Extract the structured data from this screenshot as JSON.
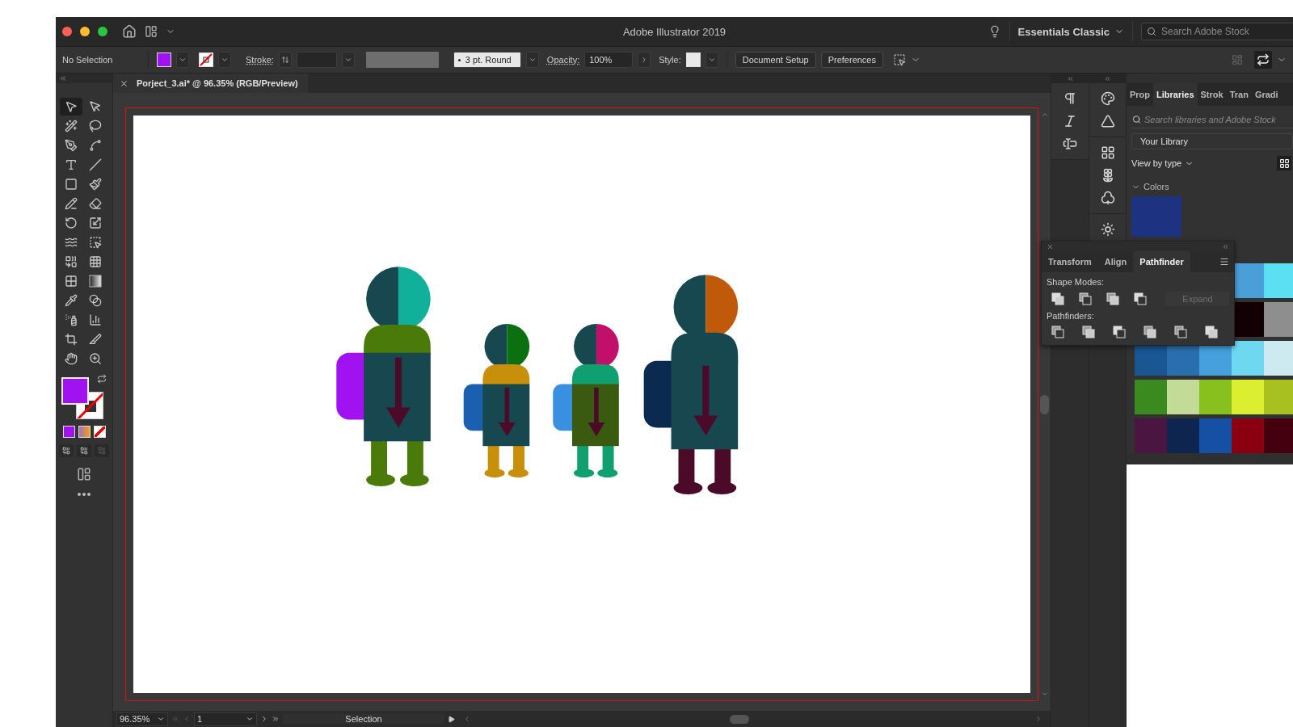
{
  "window": {
    "title": "Adobe Illustrator 2019"
  },
  "workspace": {
    "label": "Essentials Classic"
  },
  "stock_search": {
    "placeholder": "Search Adobe Stock"
  },
  "control_bar": {
    "selection": "No Selection",
    "stroke_label": "Stroke:",
    "brush": "3 pt. Round",
    "opacity_label": "Opacity:",
    "opacity": "100%",
    "style_label": "Style:",
    "buttons": [
      "Document Setup",
      "Preferences"
    ]
  },
  "document_tab": {
    "title": "Porject_3.ai* @ 96.35% (RGB/Preview)"
  },
  "tools": [
    {
      "kind": "selection",
      "selected": true
    },
    {
      "kind": "direct-selection",
      "selected": false
    },
    {
      "kind": "magic-wand",
      "selected": false
    },
    {
      "kind": "lasso",
      "selected": false
    },
    {
      "kind": "pen",
      "selected": false
    },
    {
      "kind": "curvature",
      "selected": false
    },
    {
      "kind": "type",
      "selected": false
    },
    {
      "kind": "line",
      "selected": false
    },
    {
      "kind": "rectangle",
      "selected": false
    },
    {
      "kind": "paintbrush",
      "selected": false
    },
    {
      "kind": "shaper",
      "selected": false
    },
    {
      "kind": "eraser",
      "selected": false
    },
    {
      "kind": "rotate",
      "selected": false
    },
    {
      "kind": "scale",
      "selected": false
    },
    {
      "kind": "warp",
      "selected": false
    },
    {
      "kind": "free-transform",
      "selected": false
    },
    {
      "kind": "shape-builder",
      "selected": false
    },
    {
      "kind": "perspective",
      "selected": false
    },
    {
      "kind": "mesh",
      "selected": false
    },
    {
      "kind": "gradient",
      "selected": false
    },
    {
      "kind": "eyedropper",
      "selected": false
    },
    {
      "kind": "blend",
      "selected": false
    },
    {
      "kind": "symbol-sprayer",
      "selected": false
    },
    {
      "kind": "graph",
      "selected": false
    },
    {
      "kind": "artboard",
      "selected": false
    },
    {
      "kind": "slice",
      "selected": false
    },
    {
      "kind": "hand",
      "selected": false
    },
    {
      "kind": "zoom",
      "selected": false
    }
  ],
  "status_bar": {
    "zoom": "96.35%",
    "artboard": "1",
    "tool": "Selection"
  },
  "libraries_panel": {
    "tabs": [
      {
        "label": "Prop",
        "selected": false
      },
      {
        "label": "Libraries",
        "selected": true
      },
      {
        "label": "Strok",
        "selected": false
      },
      {
        "label": "Tran",
        "selected": false
      },
      {
        "label": "Gradi",
        "selected": false
      }
    ],
    "search": {
      "placeholder": "Search libraries and Adobe Stock"
    },
    "library": "Your Library",
    "view": "View by type",
    "section": "Colors",
    "swatch": {
      "color": "#1e3282"
    },
    "color_rows": [
      {
        "swatches": [
          {
            "color": "#4a9fd8"
          },
          {
            "color": "#5ae0f2"
          }
        ]
      },
      {
        "swatches": [
          {
            "color": "#120004"
          },
          {
            "color": "#8e8e8e"
          }
        ]
      },
      {
        "swatches": [
          {
            "color": "#1a5691"
          },
          {
            "color": "#2a6fad"
          },
          {
            "color": "#45a0dc"
          },
          {
            "color": "#6dd8ef"
          },
          {
            "color": "#cdeaf0"
          }
        ]
      },
      {
        "swatches": [
          {
            "color": "#3a8a20"
          },
          {
            "color": "#c2dc98"
          },
          {
            "color": "#88c020"
          },
          {
            "color": "#dcee30"
          },
          {
            "color": "#a8c020"
          }
        ]
      },
      {
        "swatches": [
          {
            "color": "#4a1540"
          },
          {
            "color": "#0e2550"
          },
          {
            "color": "#1550a5"
          },
          {
            "color": "#8a0010"
          },
          {
            "color": "#450010"
          }
        ]
      }
    ]
  },
  "pathfinder_panel": {
    "tabs": [
      {
        "label": "Transform",
        "selected": false
      },
      {
        "label": "Align",
        "selected": false
      },
      {
        "label": "Pathfinder",
        "selected": true
      }
    ],
    "shape_modes_label": "Shape Modes:",
    "expand": {
      "label": "Expand",
      "disabled": true
    },
    "pathfinders_label": "Pathfinders:"
  }
}
